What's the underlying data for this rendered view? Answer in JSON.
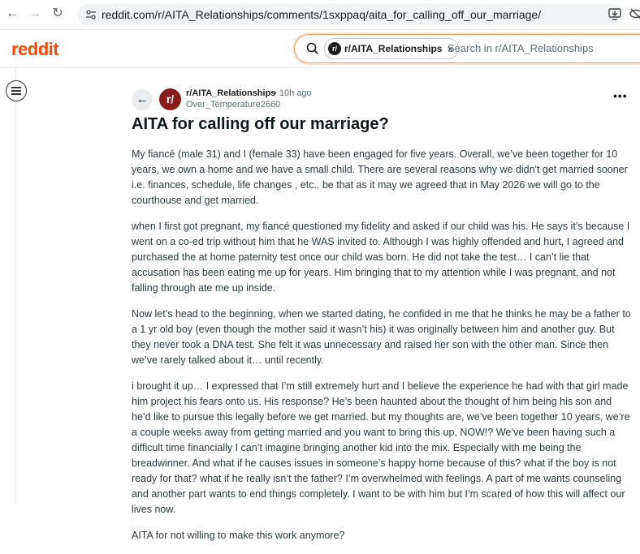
{
  "browser": {
    "url": "reddit.com/r/AITA_Relationships/comments/1sxppaq/aita_for_calling_off_our_marriage/"
  },
  "header": {
    "logo": "reddit",
    "search": {
      "community_chip": "r/AITA_Relationships",
      "chip_close": "×",
      "placeholder": "Search in r/AITA_Relationships"
    }
  },
  "post": {
    "subreddit": "r/AITA_Relationships",
    "time": "• 10h ago",
    "author": "Over_Temperature2660",
    "more": "•••",
    "title": "AITA for calling off our marriage?",
    "paragraphs": [
      "My fiancé (male 31) and I (female 33) have been engaged for five years. Overall, we’ve been together for 10 years, we own a home and we have a small child. There are several reasons why we didn't get married sooner i.e. finances, schedule, life changes , etc.. be that as it may we agreed that in May 2026 we will go to the courthouse and get married.",
      "when I first got pregnant, my fiancé questioned my fidelity and asked if our child was his. He says it’s because I went on a co-ed trip without him that he WAS invited to. Although I was highly offended and hurt, I agreed and purchased the at home paternity test once our child was born. He did not take the test… I can’t lie that accusation has been eating me up for years. Him bringing that to my attention while I was pregnant, and not falling through ate me up inside.",
      "Now let’s head to the beginning, when we started dating, he confided in me that he thinks he may be a father to a 1 yr old boy (even though the mother said it wasn’t his) it was originally between him and another guy. But they never took a DNA test. She felt it was unnecessary and raised her son with the other man. Since then we’ve rarely talked about it… until recently.",
      "i brought it up… I expressed that I’m still extremely hurt and I believe the experience he had with that girl made him project his fears onto us. His response? He’s been haunted about the thought of him being his son and he’d like to pursue this legally before we get married. but my thoughts are, we’ve been together 10 years, we’re a couple weeks away from getting married and you want to bring this up, NOW!? We’ve been having such a difficult time financially I can’t imagine bringing another kid into the mix. Especially with me being the breadwinner. And what if he causes issues in someone’s happy home because of this? what if the boy is not ready for that? what if he really isn’t the father? I’m overwhelmed with feelings. A part of me wants counseling and another part wants to end things completely. I want to be with him but I’m scared of how this will affect our lives now.",
      "AITA for not willing to make this work anymore?"
    ]
  },
  "colors": {
    "brand": "#ff4500",
    "subreddit_avatar": "#8b1a1a"
  }
}
